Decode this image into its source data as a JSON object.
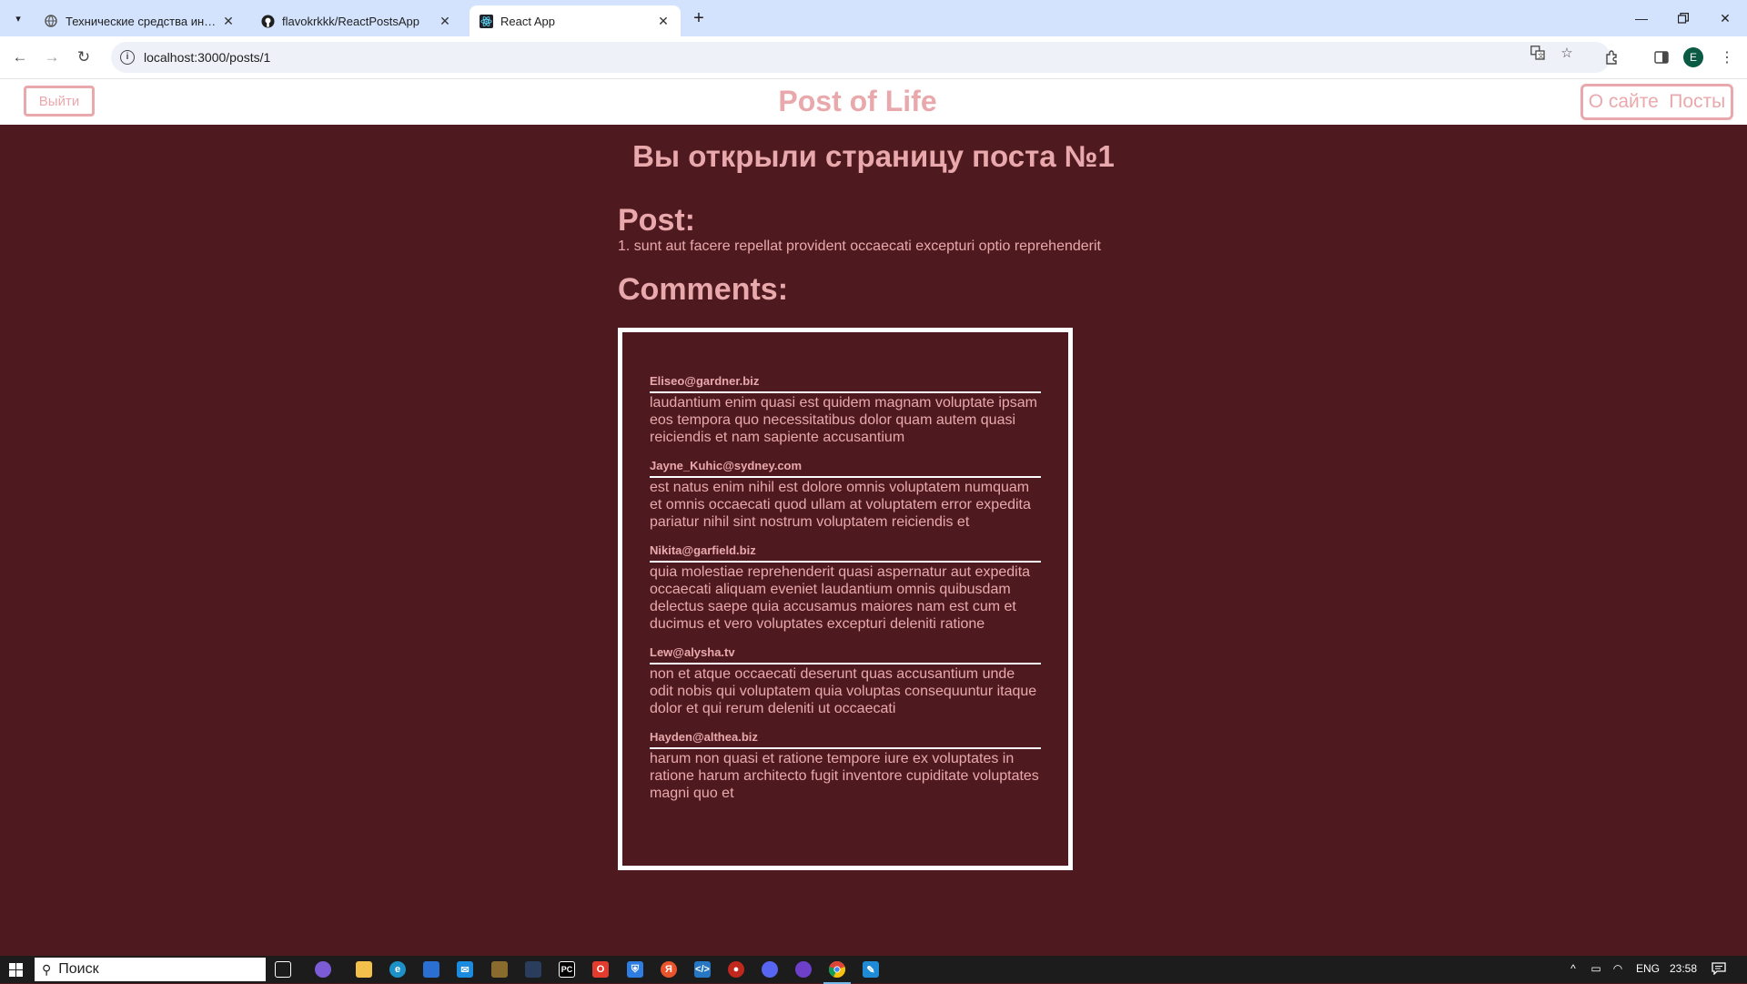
{
  "browser": {
    "tabs": [
      {
        "title": "Технические средства информ…",
        "active": false
      },
      {
        "title": "flavokrkkk/ReactPostsApp",
        "active": false
      },
      {
        "title": "React App",
        "active": true
      }
    ],
    "url": "localhost:3000/posts/1",
    "profile_initial": "E"
  },
  "header": {
    "logout_label": "Выйти",
    "brand": "Post of Life",
    "nav": [
      "О сайте",
      "Посты"
    ]
  },
  "page": {
    "title": "Вы открыли страницу поста №1",
    "post_heading": "Post:",
    "post_text": "1. sunt aut facere repellat provident occaecati excepturi optio reprehenderit",
    "comments_heading": "Comments:",
    "comments": [
      {
        "email": "Eliseo@gardner.biz",
        "body": "laudantium enim quasi est quidem magnam voluptate ipsam eos tempora quo necessitatibus dolor quam autem quasi reiciendis et nam sapiente accusantium"
      },
      {
        "email": "Jayne_Kuhic@sydney.com",
        "body": "est natus enim nihil est dolore omnis voluptatem numquam et omnis occaecati quod ullam at voluptatem error expedita pariatur nihil sint nostrum voluptatem reiciendis et"
      },
      {
        "email": "Nikita@garfield.biz",
        "body": "quia molestiae reprehenderit quasi aspernatur aut expedita occaecati aliquam eveniet laudantium omnis quibusdam delectus saepe quia accusamus maiores nam est cum et ducimus et vero voluptates excepturi deleniti ratione"
      },
      {
        "email": "Lew@alysha.tv",
        "body": "non et atque occaecati deserunt quas accusantium unde odit nobis qui voluptatem quia voluptas consequuntur itaque dolor et qui rerum deleniti ut occaecati"
      },
      {
        "email": "Hayden@althea.biz",
        "body": "harum non quasi et ratione tempore iure ex voluptates in ratione harum architecto fugit inventore cupiditate voluptates magni quo et"
      }
    ]
  },
  "taskbar": {
    "search_placeholder": "Поиск",
    "language": "ENG",
    "time": "23:58"
  },
  "colors": {
    "page_background": "#4f1a1f",
    "accent_pink": "#e9a9ac",
    "tab_strip": "#d3e3fd"
  }
}
